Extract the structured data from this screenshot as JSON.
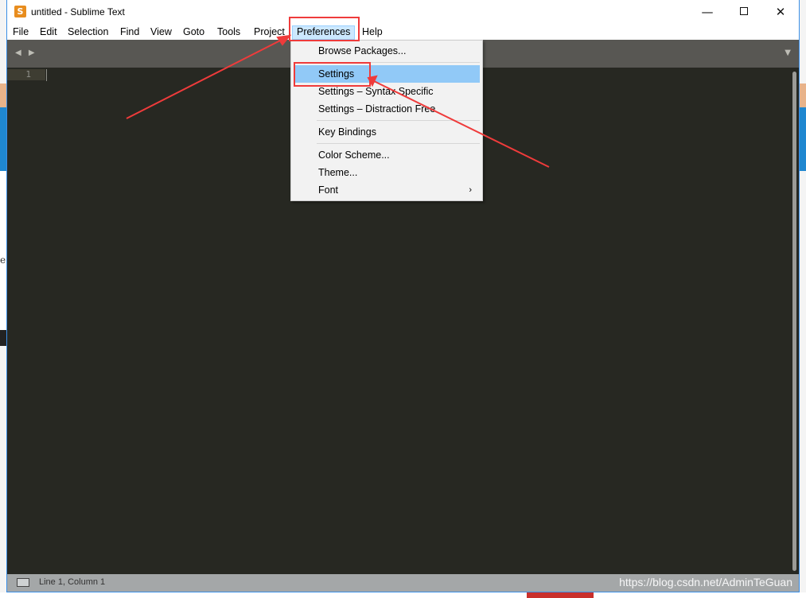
{
  "window": {
    "title": "untitled - Sublime Text",
    "minimize_glyph": "—",
    "close_glyph": "✕"
  },
  "menubar": {
    "items": [
      "File",
      "Edit",
      "Selection",
      "Find",
      "View",
      "Goto",
      "Tools",
      "Project",
      "Preferences",
      "Help"
    ],
    "active_item": "Preferences"
  },
  "tabbar": {
    "nav_arrows": "◀ ▶",
    "dropdown_glyph": "▼"
  },
  "editor": {
    "line_numbers": [
      "1"
    ],
    "background": "#272822"
  },
  "preferences_menu": {
    "items": [
      {
        "label": "Browse Packages..."
      },
      {
        "label": "Settings",
        "highlighted": true
      },
      {
        "label": "Settings – Syntax Specific"
      },
      {
        "label": "Settings – Distraction Free"
      },
      {
        "label": "Key Bindings"
      },
      {
        "label": "Color Scheme..."
      },
      {
        "label": "Theme..."
      },
      {
        "label": "Font",
        "submenu_glyph": "›"
      }
    ]
  },
  "statusbar": {
    "position_text": "Line 1, Column 1"
  },
  "watermark": "https://blog.csdn.net/AdminTeGuan",
  "background_letter": "e",
  "annotation_color": "#ef3b3b"
}
